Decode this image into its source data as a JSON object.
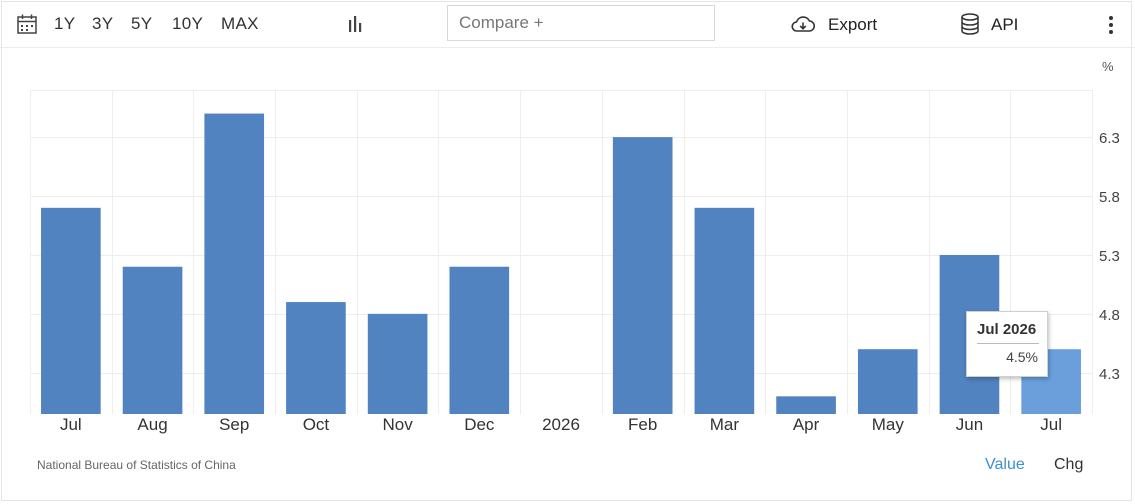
{
  "toolbar": {
    "ranges": [
      "1Y",
      "3Y",
      "5Y",
      "10Y",
      "MAX"
    ],
    "compare_placeholder": "Compare +",
    "export_label": "Export",
    "api_label": "API",
    "icons": {
      "calendar": "calendar-icon",
      "chart_type": "bar-chart-icon",
      "export": "cloud-download-icon",
      "api": "database-icon",
      "more": "more-vertical-icon"
    }
  },
  "chart_data": {
    "type": "bar",
    "categories": [
      "Jul",
      "Aug",
      "Sep",
      "Oct",
      "Nov",
      "Dec",
      "2026",
      "Feb",
      "Mar",
      "Apr",
      "May",
      "Jun",
      "Jul"
    ],
    "values": [
      5.7,
      5.2,
      6.5,
      4.9,
      4.8,
      5.2,
      null,
      6.3,
      5.7,
      4.1,
      4.5,
      5.3,
      4.5
    ],
    "title": "",
    "xlabel": "",
    "ylabel": "%",
    "y_ticks": [
      4.3,
      4.8,
      5.3,
      5.8,
      6.3
    ],
    "ylim": [
      3.95,
      6.7
    ],
    "grid": true,
    "bar_color": "#5083bf",
    "highlight_color": "#6a9fdc",
    "highlight_index": 12
  },
  "tooltip": {
    "title": "Jul 2026",
    "value": "4.5%"
  },
  "footer": {
    "source": "National Bureau of Statistics of China",
    "value_label": "Value",
    "chg_label": "Chg"
  }
}
